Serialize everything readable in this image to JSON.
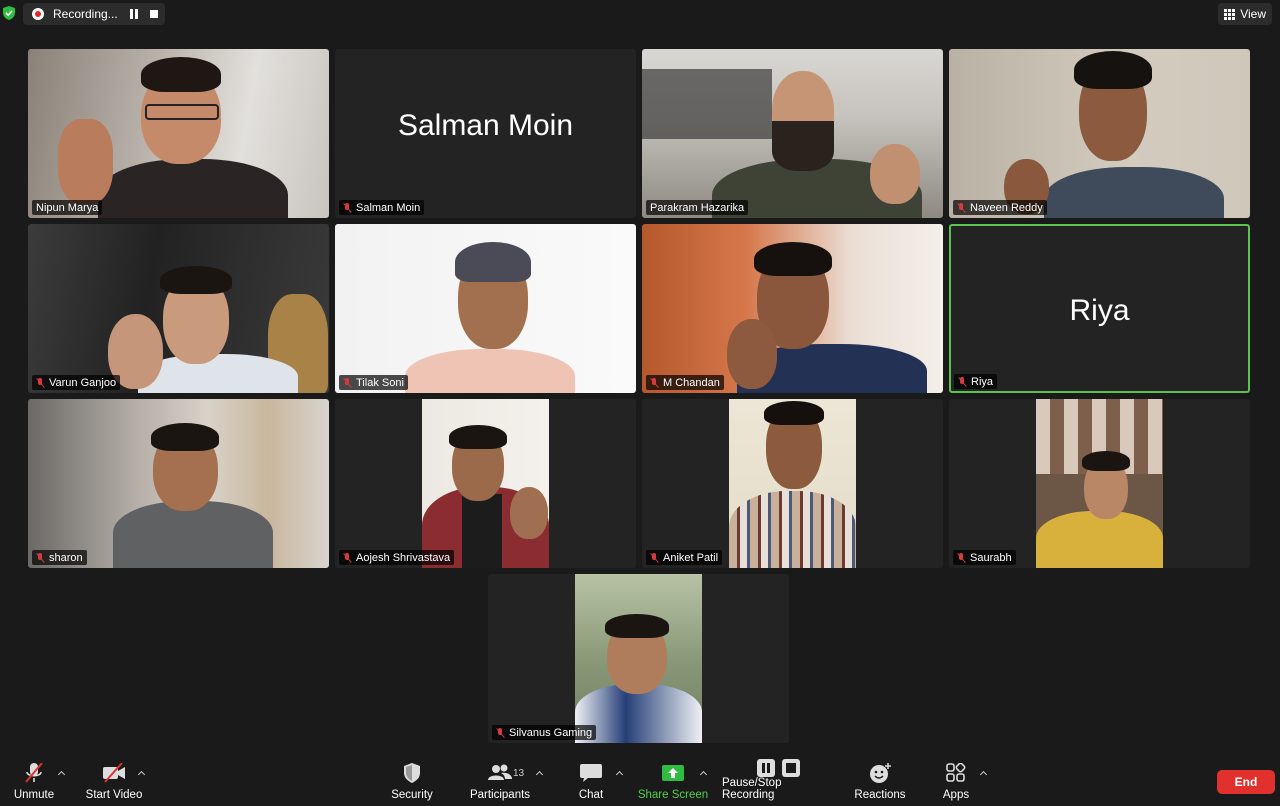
{
  "top_bar": {
    "recording_label": "Recording...",
    "view_label": "View"
  },
  "participants": [
    {
      "name": "Nipun Marya",
      "muted": false,
      "video": true
    },
    {
      "name": "Salman Moin",
      "muted": true,
      "video": false
    },
    {
      "name": "Parakram Hazarika",
      "muted": false,
      "video": true
    },
    {
      "name": "Naveen Reddy",
      "muted": true,
      "video": true
    },
    {
      "name": "Varun Ganjoo",
      "muted": true,
      "video": true
    },
    {
      "name": "Tilak Soni",
      "muted": true,
      "video": true
    },
    {
      "name": "M Chandan",
      "muted": true,
      "video": true
    },
    {
      "name": "Riya",
      "muted": true,
      "video": false,
      "active_speaker": true
    },
    {
      "name": "sharon",
      "muted": true,
      "video": true
    },
    {
      "name": "Aojesh Shrivastava",
      "muted": true,
      "video": true
    },
    {
      "name": "Aniket Patil",
      "muted": true,
      "video": true
    },
    {
      "name": "Saurabh",
      "muted": true,
      "video": true
    },
    {
      "name": "Silvanus Gaming",
      "muted": true,
      "video": true
    }
  ],
  "toolbar": {
    "unmute": "Unmute",
    "start_video": "Start Video",
    "security": "Security",
    "participants": "Participants",
    "participants_count": "13",
    "chat": "Chat",
    "share_screen": "Share Screen",
    "pause_stop_recording": "Pause/Stop Recording",
    "reactions": "Reactions",
    "apps": "Apps",
    "end": "End"
  },
  "colors": {
    "active_speaker_border": "#5cc34e",
    "share_screen": "#4fd24a",
    "end_button": "#e0312c",
    "muted_icon": "#d23c3c"
  }
}
